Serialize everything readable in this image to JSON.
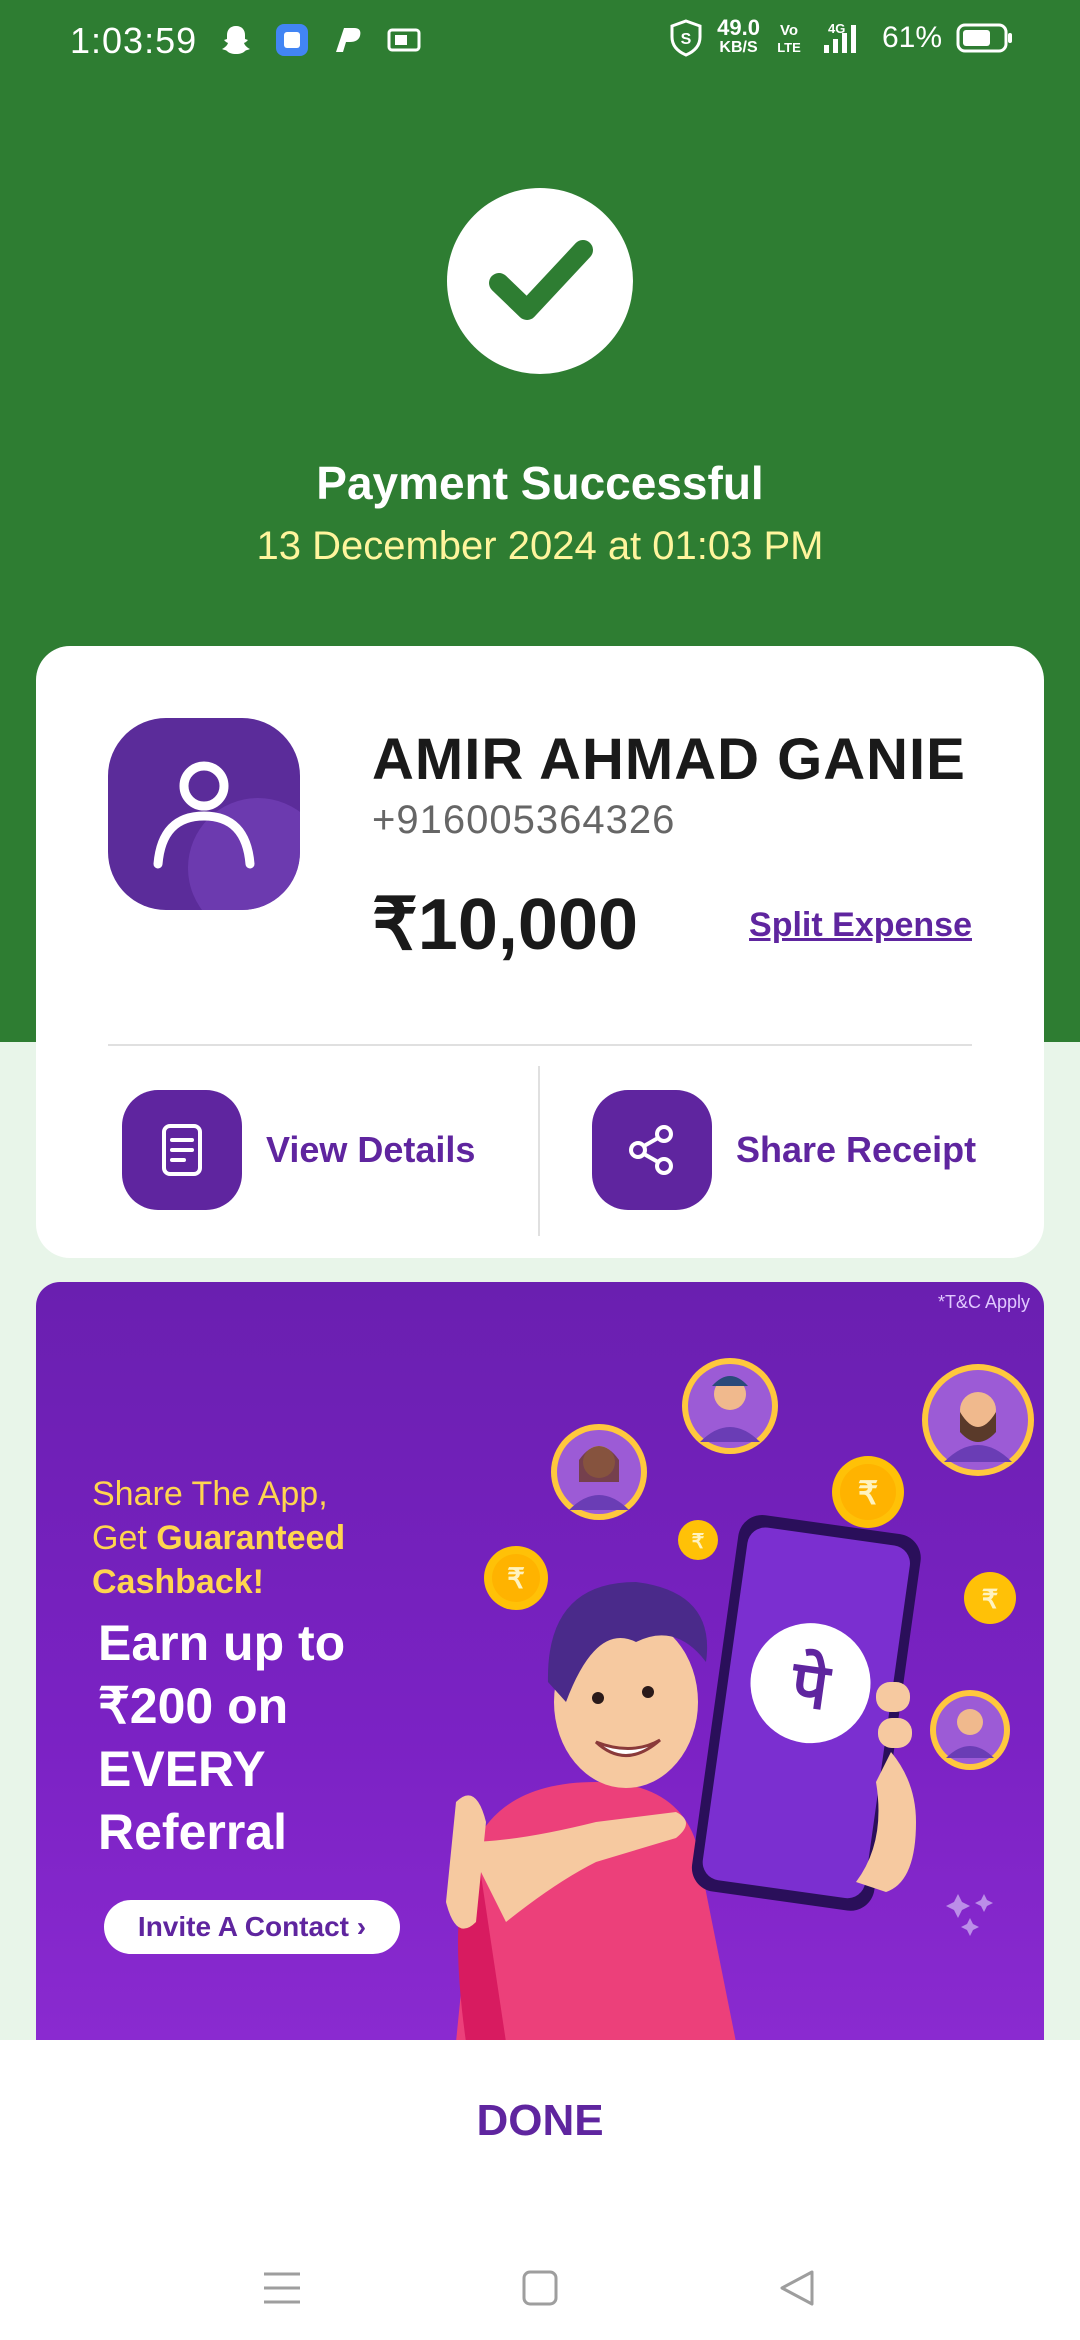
{
  "status_bar": {
    "time": "1:03:59",
    "speed_value": "49.0",
    "speed_unit": "KB/S",
    "volte": "Vo LTE",
    "network": "4G",
    "battery_pct": "61%"
  },
  "header": {
    "title": "Payment Successful",
    "datetime": "13 December 2024 at 01:03 PM"
  },
  "payee": {
    "name": "AMIR AHMAD GANIE",
    "phone": "+916005364326",
    "amount": "₹10,000",
    "split_label": "Split Expense"
  },
  "actions": {
    "view_details": "View Details",
    "share_receipt": "Share Receipt"
  },
  "banner": {
    "tnc": "*T&C Apply",
    "line1a": "Share The App,",
    "line1b_pre": "Get ",
    "line1b_bold": "Guaranteed",
    "line1c": "Cashback!",
    "big_text": "Earn up to ₹200 on EVERY Referral",
    "invite_label": "Invite A Contact ›",
    "logo_char": "पे"
  },
  "footer": {
    "done_label": "DONE"
  },
  "colors": {
    "green": "#2e7d32",
    "purple": "#5f259f",
    "date_yellow": "#fff59d"
  }
}
